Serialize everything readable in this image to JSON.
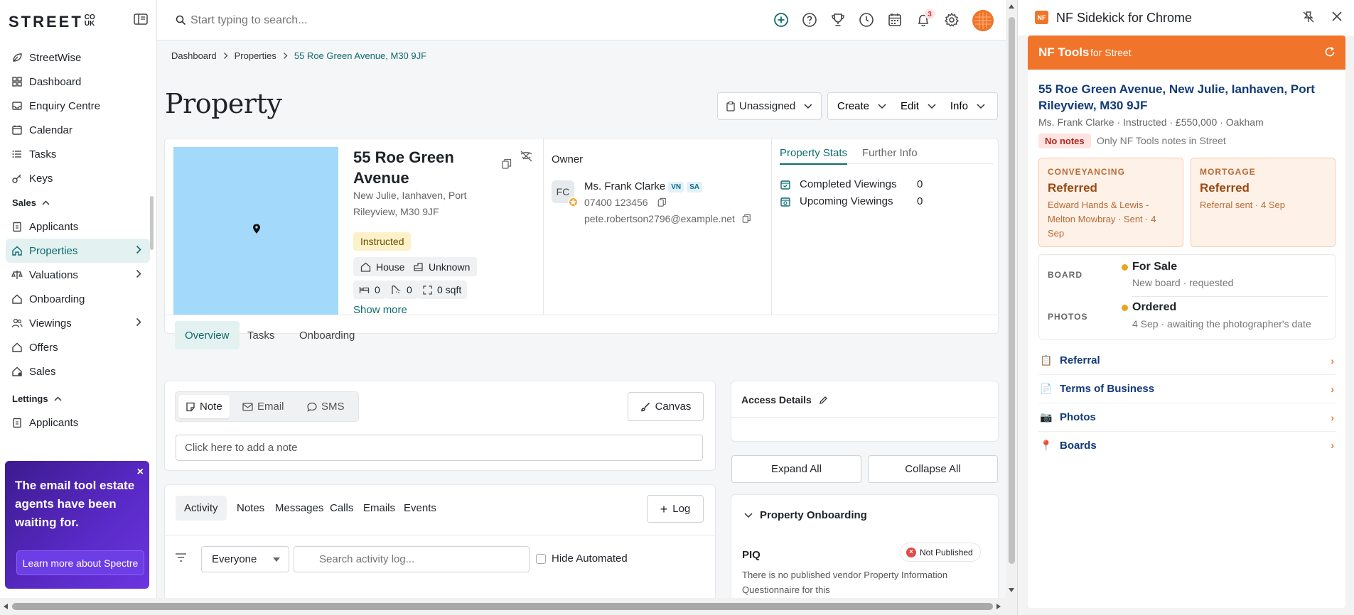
{
  "app": {
    "logo_text": "STREET",
    "logo_suffix": "CO UK",
    "search_placeholder": "Start typing to search...",
    "notification_count": "3",
    "icons": [
      "plus-circle-icon",
      "help-icon",
      "trophy-icon",
      "clock-icon",
      "calendar-icon",
      "bell-icon",
      "gear-icon"
    ]
  },
  "sidebar": {
    "items": [
      {
        "label": "StreetWise",
        "icon": "leaf-icon"
      },
      {
        "label": "Dashboard",
        "icon": "grid-icon"
      },
      {
        "label": "Enquiry Centre",
        "icon": "inbox-icon"
      },
      {
        "label": "Calendar",
        "icon": "calendar-icon"
      },
      {
        "label": "Tasks",
        "icon": "list-icon"
      },
      {
        "label": "Keys",
        "icon": "key-icon"
      }
    ],
    "sales_section": "Sales",
    "sales_items": [
      {
        "label": "Applicants",
        "icon": "clipboard-icon"
      },
      {
        "label": "Properties",
        "icon": "home-icon",
        "active": true
      },
      {
        "label": "Valuations",
        "icon": "scale-icon"
      },
      {
        "label": "Onboarding",
        "icon": "house-check-icon"
      },
      {
        "label": "Viewings",
        "icon": "users-icon"
      },
      {
        "label": "Offers",
        "icon": "house-offer-icon"
      },
      {
        "label": "Sales",
        "icon": "house-sold-icon"
      }
    ],
    "lettings_section": "Lettings",
    "lettings_items": [
      {
        "label": "Applicants",
        "icon": "clipboard-icon"
      }
    ],
    "promo": {
      "text": "The email tool estate agents have been waiting for.",
      "button": "Learn more about Spectre",
      "close": "×"
    }
  },
  "breadcrumb": [
    "Dashboard",
    "Properties",
    "55 Roe Green Avenue, M30 9JF"
  ],
  "page": {
    "title": "Property",
    "assign_label": "Unassigned",
    "create_label": "Create",
    "edit_label": "Edit",
    "info_label": "Info"
  },
  "property": {
    "title": "55 Roe Green Avenue",
    "address": "New Julie, Ianhaven, Port Rileyview, M30 9JF",
    "status": "Instructed",
    "type": "House",
    "tenure": "Unknown",
    "bedrooms": "0",
    "bathrooms": "0",
    "area": "0 sqft",
    "show_more": "Show more",
    "owner_label": "Owner",
    "owner_initials": "FC",
    "owner_name": "Ms. Frank Clarke",
    "owner_tags": [
      "VN",
      "SA"
    ],
    "owner_phone": "07400 123456",
    "owner_email": "pete.robertson2796@example.net",
    "stats_tabs": [
      "Property Stats",
      "Further Info"
    ],
    "stats": [
      {
        "label": "Completed Viewings",
        "value": "0"
      },
      {
        "label": "Upcoming Viewings",
        "value": "0"
      }
    ],
    "tabs": [
      "Overview",
      "Tasks",
      "Onboarding"
    ]
  },
  "note": {
    "tabs": [
      "Note",
      "Email",
      "SMS"
    ],
    "canvas_label": "Canvas",
    "placeholder": "Click here to add a note"
  },
  "activity": {
    "tabs": [
      "Activity",
      "Notes",
      "Messages",
      "Calls",
      "Emails",
      "Events"
    ],
    "log_label": "Log",
    "filter_value": "Everyone",
    "search_placeholder": "Search activity log...",
    "hide_automated": "Hide Automated"
  },
  "access": {
    "title": "Access Details",
    "expand_all": "Expand All",
    "collapse_all": "Collapse All"
  },
  "onboarding": {
    "title": "Property Onboarding",
    "piq_label": "PIQ",
    "piq_status": "Not Published",
    "piq_desc": "There is no published vendor Property Information Questionnaire for this"
  },
  "sidekick": {
    "title": "NF Sidekick for Chrome",
    "logo": "NF",
    "bar_title": "NF Tools",
    "bar_sub": "for Street",
    "address": "55 Roe Green Avenue, New Julie, Ianhaven, Port Rileyview, M30 9JF",
    "meta": "Ms. Frank Clarke · Instructed · £550,000 · Oakham",
    "no_notes": "No notes",
    "no_notes_hint": "Only NF Tools notes in Street",
    "conveyancing": {
      "label": "CONVEYANCING",
      "status": "Referred",
      "detail": "Edward Hands & Lewis - Melton Mowbray · Sent · 4 Sep"
    },
    "mortgage": {
      "label": "MORTGAGE",
      "status": "Referred",
      "detail": "Referral sent · 4 Sep"
    },
    "board": {
      "label": "BOARD",
      "status": "For Sale",
      "detail": "New board · requested",
      "dot_color": "#e9a520"
    },
    "photos": {
      "label": "PHOTOS",
      "status": "Ordered",
      "detail": "4 Sep · awaiting the photographer's date",
      "dot_color": "#e9a520"
    },
    "links": [
      {
        "label": "Referral",
        "icon": "clipboard-icon"
      },
      {
        "label": "Terms of Business",
        "icon": "document-icon"
      },
      {
        "label": "Photos",
        "icon": "camera-icon"
      },
      {
        "label": "Boards",
        "icon": "pin-icon"
      }
    ],
    "accent": "#f0752a"
  }
}
